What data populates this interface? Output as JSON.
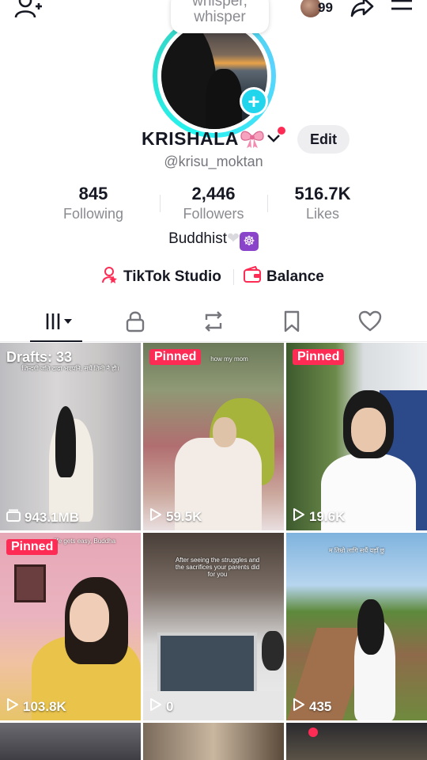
{
  "note": {
    "line1": "whisper,",
    "line2": "whisper"
  },
  "streak": {
    "count": "99"
  },
  "profile": {
    "display_name": "KRISHALA",
    "edit_label": "Edit",
    "username": "@krisu_moktan",
    "bio": "Buddhist"
  },
  "stats": [
    {
      "value": "845",
      "label": "Following"
    },
    {
      "value": "2,446",
      "label": "Followers"
    },
    {
      "value": "516.7K",
      "label": "Likes"
    }
  ],
  "links": {
    "studio": "TikTok Studio",
    "balance": "Balance"
  },
  "tabs": [
    "videos-icon",
    "lock-icon",
    "repost-icon",
    "bookmark-icon",
    "heart-icon"
  ],
  "colors": {
    "accent": "#fe2c55",
    "ring": "#25f4ee",
    "plus": "#20d5ec",
    "wheel": "#8a44c9"
  },
  "grid": [
    {
      "drafts": "Drafts: 33",
      "stat": "943.1MB",
      "caption": "जिन्दगी जति टाढा भएपनि, सधैं तिमी नै हौ।"
    },
    {
      "pinned": "Pinned",
      "stat": "59.5K",
      "caption": "how my mom"
    },
    {
      "pinned": "Pinned",
      "stat": "19.6K",
      "caption": ""
    },
    {
      "pinned": "Pinned",
      "stat": "103.8K",
      "caption": "life gets easy, Buddha"
    },
    {
      "stat": "0",
      "caption": "After seeing the struggles and the sacrifices your parents did for you"
    },
    {
      "stat": "435",
      "caption": "म तिम्रो लागि सधैं यहाँ छु"
    }
  ]
}
